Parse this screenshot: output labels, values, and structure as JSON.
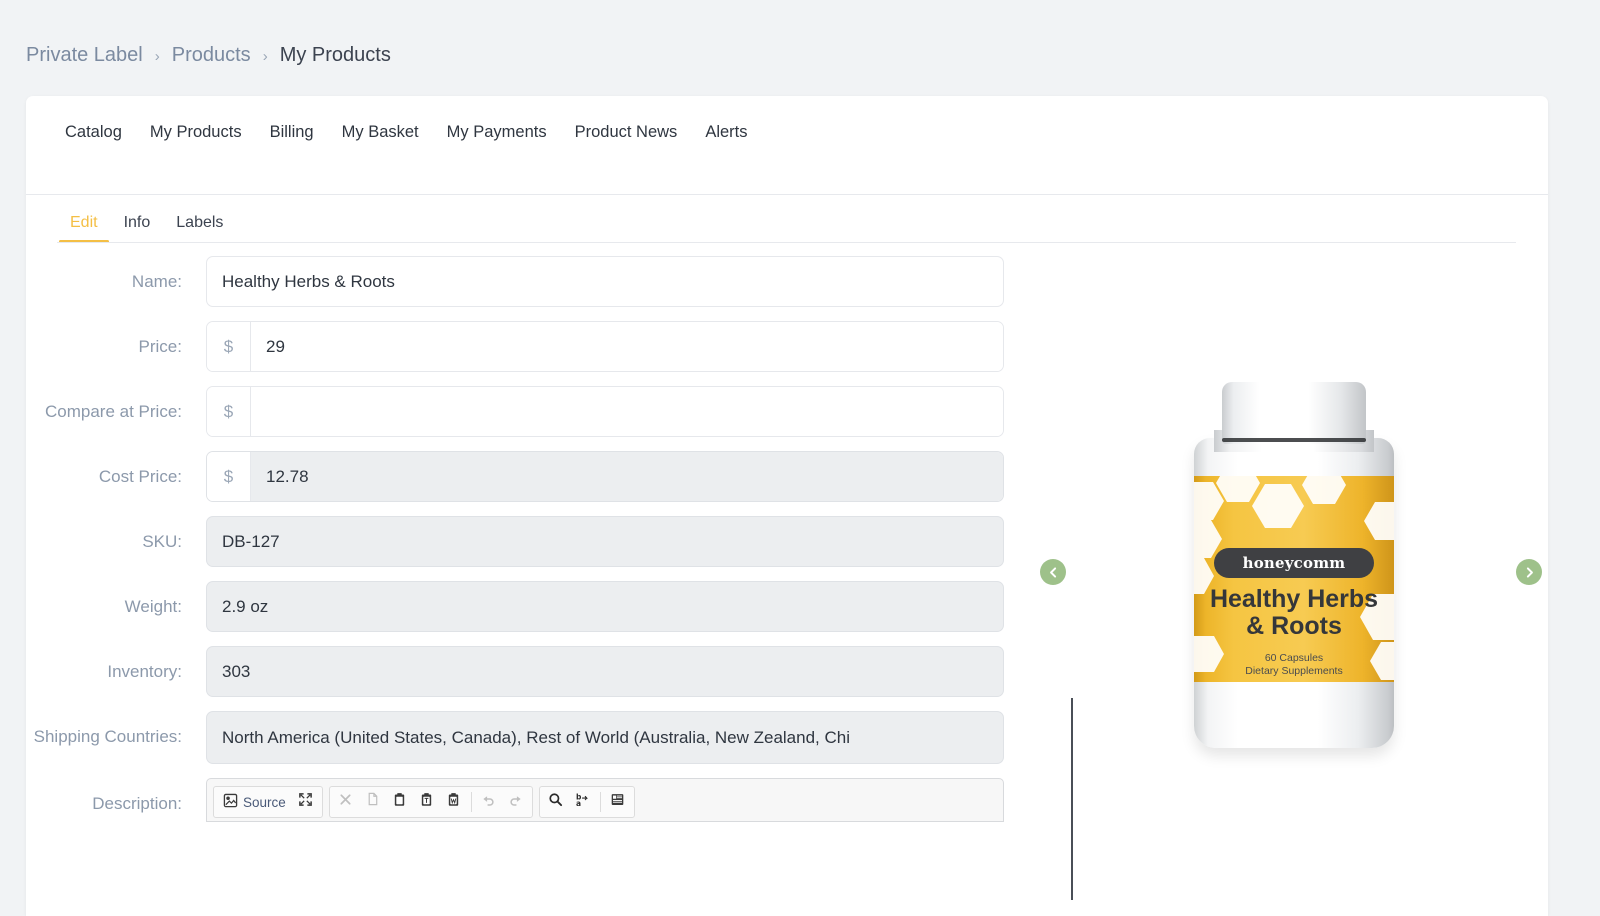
{
  "breadcrumb": [
    {
      "label": "Private Label",
      "current": false
    },
    {
      "label": "Products",
      "current": false
    },
    {
      "label": "My Products",
      "current": true
    }
  ],
  "breadcrumb_separator": "›",
  "nav_tabs": [
    {
      "label": "Catalog",
      "active": false
    },
    {
      "label": "My Products",
      "active": false
    },
    {
      "label": "Billing",
      "active": false
    },
    {
      "label": "My Basket",
      "active": false
    },
    {
      "label": "My Payments",
      "active": false
    },
    {
      "label": "Product News",
      "active": false
    },
    {
      "label": "Alerts",
      "active": false
    }
  ],
  "sub_tabs": [
    {
      "label": "Edit",
      "active": true
    },
    {
      "label": "Info",
      "active": false
    },
    {
      "label": "Labels",
      "active": false
    }
  ],
  "form": {
    "name": {
      "label": "Name:",
      "value": "Healthy Herbs & Roots",
      "disabled": false
    },
    "price": {
      "label": "Price:",
      "prefix": "$",
      "value": "29",
      "disabled": false
    },
    "compare_at_price": {
      "label": "Compare at Price:",
      "prefix": "$",
      "value": "",
      "disabled": false
    },
    "cost_price": {
      "label": "Cost Price:",
      "prefix": "$",
      "value": "12.78",
      "disabled": true
    },
    "sku": {
      "label": "SKU:",
      "value": "DB-127",
      "disabled": true
    },
    "weight": {
      "label": "Weight:",
      "value": "2.9 oz",
      "disabled": true
    },
    "inventory": {
      "label": "Inventory:",
      "value": "303",
      "disabled": true
    },
    "shipping_countries": {
      "label": "Shipping Countries:",
      "value": "North America (United States, Canada), Rest of World (Australia, New Zealand, Chi",
      "disabled": true
    },
    "description": {
      "label": "Description:"
    }
  },
  "editor_toolbar": {
    "source_label": "Source",
    "buttons": [
      {
        "name": "source-button",
        "icon": "source-icon"
      },
      {
        "name": "maximize-button",
        "icon": "maximize-icon"
      },
      {
        "name": "cut-button",
        "icon": "cut-icon"
      },
      {
        "name": "copy-button",
        "icon": "copy-icon"
      },
      {
        "name": "paste-button",
        "icon": "paste-icon"
      },
      {
        "name": "paste-text-button",
        "icon": "paste-text-icon"
      },
      {
        "name": "paste-word-button",
        "icon": "paste-word-icon"
      },
      {
        "name": "undo-button",
        "icon": "undo-icon"
      },
      {
        "name": "redo-button",
        "icon": "redo-icon"
      },
      {
        "name": "find-button",
        "icon": "search-icon"
      },
      {
        "name": "replace-button",
        "icon": "replace-icon"
      },
      {
        "name": "templates-button",
        "icon": "templates-icon"
      }
    ]
  },
  "product_image": {
    "brand": "honeycomm",
    "title_line_1": "Healthy Herbs",
    "title_line_2": "& Roots",
    "capsules": "60 Capsules",
    "supplement_text": "Dietary Supplements"
  },
  "carousel": {
    "prev_icon": "chevron-left-icon",
    "next_icon": "chevron-right-icon"
  },
  "colors": {
    "page_background": "#f1f3f5",
    "card_background": "#ffffff",
    "accent": "#f4bf45",
    "label_text": "#8c99ab",
    "value_text": "#2f3640",
    "disabled_field": "#eceef0",
    "carousel_green": "#9ec18a",
    "label_yellow": "#f5c542"
  }
}
